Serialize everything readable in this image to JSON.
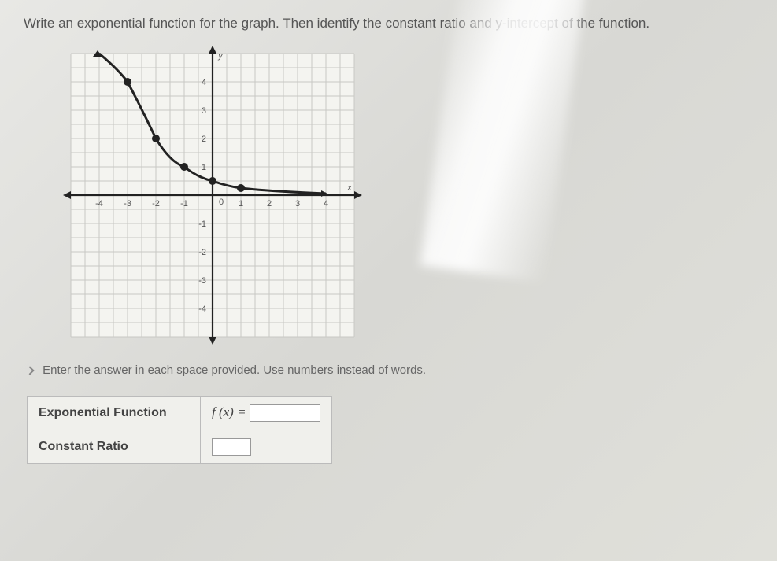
{
  "question": "Write an exponential function for the graph. Then identify the constant ratio and y-intercept of the function.",
  "instructions": "Enter the answer in each space provided. Use numbers instead of words.",
  "table": {
    "row1_label": "Exponential Function",
    "row1_prefix": "f (x) =",
    "row2_label": "Constant Ratio"
  },
  "chart_data": {
    "type": "line",
    "title": "",
    "xlabel": "x",
    "ylabel": "y",
    "xlim": [
      -5,
      5
    ],
    "ylim": [
      -5,
      5
    ],
    "x_ticks": [
      -4,
      -3,
      -2,
      -1,
      0,
      1,
      2,
      3,
      4
    ],
    "y_ticks": [
      -4,
      -3,
      -2,
      -1,
      1,
      2,
      3,
      4
    ],
    "series": [
      {
        "name": "f(x)",
        "points": [
          {
            "x": -4,
            "y": 5
          },
          {
            "x": -3,
            "y": 4
          },
          {
            "x": -2,
            "y": 2
          },
          {
            "x": -1,
            "y": 1
          },
          {
            "x": 0,
            "y": 0.5
          },
          {
            "x": 1,
            "y": 0.25
          },
          {
            "x": 2,
            "y": 0.125
          },
          {
            "x": 4,
            "y": 0.03
          }
        ],
        "marked_points": [
          {
            "x": -3,
            "y": 4
          },
          {
            "x": -2,
            "y": 2
          },
          {
            "x": -1,
            "y": 1
          },
          {
            "x": 0,
            "y": 0.5
          },
          {
            "x": 1,
            "y": 0.25
          }
        ]
      }
    ]
  }
}
